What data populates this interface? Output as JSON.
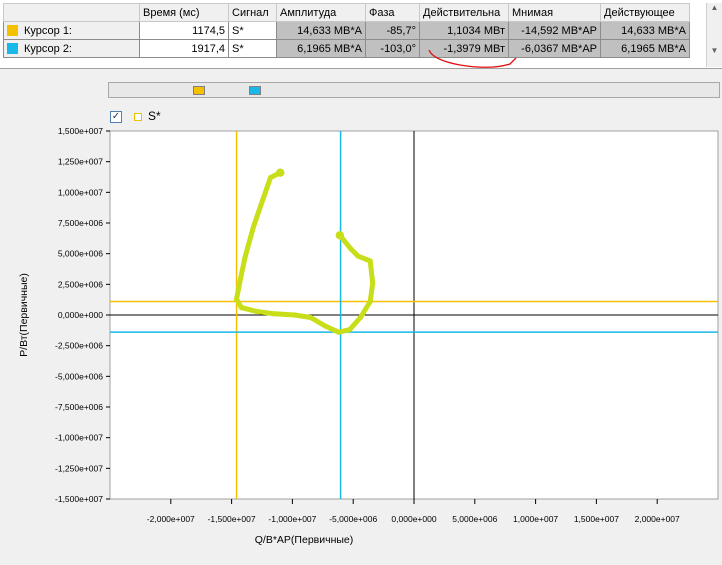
{
  "table": {
    "headers": [
      "",
      "Время (мс)",
      "Сигнал",
      "Амплитуда",
      "Фаза",
      "Действительна",
      "Мнимая",
      "Действующее"
    ],
    "rows": [
      {
        "label": "Курсор 1:",
        "color": "#f5c000",
        "time": "1174,5",
        "signal": "S*",
        "amplitude": "14,633 МВ*А",
        "phase": "-85,7°",
        "real": "1,1034 МВт",
        "imag": "-14,592 МВ*АР",
        "rms": "14,633 МВ*А"
      },
      {
        "label": "Курсор 2:",
        "color": "#18b8e8",
        "time": "1917,4",
        "signal": "S*",
        "amplitude": "6,1965 МВ*А",
        "phase": "-103,0°",
        "real": "-1,3979 МВт",
        "imag": "-6,0367 МВ*АР",
        "rms": "6,1965 МВ*А"
      }
    ]
  },
  "scroll": {
    "up": "▲",
    "down": "▼"
  },
  "legend": {
    "checkbox": "✓",
    "series": "S*"
  },
  "colors": {
    "cursor1": "#f5c000",
    "cursor2": "#18b8e8",
    "trace": "#c8de18",
    "annotation": "#e01010",
    "axis": "#000000"
  },
  "chart_data": {
    "type": "scatter",
    "xlabel": "Q/В*АР(Первичные)",
    "ylabel": "P/Вт(Первичные)",
    "xlim": [
      -25000000.0,
      25000000.0
    ],
    "ylim": [
      -15000000.0,
      15000000.0
    ],
    "x_ticks": [
      -20000000.0,
      -15000000.0,
      -10000000.0,
      -5000000.0,
      0,
      5000000.0,
      10000000.0,
      15000000.0,
      20000000.0
    ],
    "x_tick_labels": [
      "-2,000e+007",
      "-1,500e+007",
      "-1,000e+007",
      "-5,000e+006",
      "0,000e+000",
      "5,000e+006",
      "1,000e+007",
      "1,500e+007",
      "2,000e+007"
    ],
    "y_ticks": [
      15000000.0,
      12500000.0,
      10000000.0,
      7500000.0,
      5000000.0,
      2500000.0,
      0,
      -2500000.0,
      -5000000.0,
      -7500000.0,
      -10000000.0,
      -12500000.0,
      -15000000.0
    ],
    "y_tick_labels": [
      "1,500e+007",
      "1,250e+007",
      "1,000e+007",
      "7,500e+006",
      "5,000e+006",
      "2,500e+006",
      "0,000e+000",
      "-2,500e+006",
      "-5,000e+006",
      "-7,500e+006",
      "-1,000e+007",
      "-1,250e+007",
      "-1,500e+007"
    ],
    "cursor1": {
      "q": -14592000.0,
      "p": 1103400.0
    },
    "cursor2": {
      "q": -6036700.0,
      "p": -1397900.0
    },
    "series": [
      {
        "name": "S*",
        "points": [
          [
            -11000000.0,
            11600000.0
          ],
          [
            -11800000.0,
            11200000.0
          ],
          [
            -12400000.0,
            9500000.0
          ],
          [
            -13200000.0,
            7200000.0
          ],
          [
            -13900000.0,
            4700000.0
          ],
          [
            -14400000.0,
            2300000.0
          ],
          [
            -14600000.0,
            1300000.0
          ],
          [
            -14200000.0,
            600000.0
          ],
          [
            -13000000.0,
            300000.0
          ],
          [
            -11500000.0,
            100000.0
          ],
          [
            -9800000.0,
            0.0
          ],
          [
            -8500000.0,
            -200000.0
          ],
          [
            -7300000.0,
            -900000.0
          ],
          [
            -6200000.0,
            -1400000.0
          ],
          [
            -5300000.0,
            -1200000.0
          ],
          [
            -4400000.0,
            -200000.0
          ],
          [
            -3600000.0,
            1100000.0
          ],
          [
            -3400000.0,
            2600000.0
          ],
          [
            -3600000.0,
            4400000.0
          ],
          [
            -4600000.0,
            4800000.0
          ],
          [
            -5200000.0,
            5400000.0
          ],
          [
            -6100000.0,
            6500000.0
          ]
        ]
      }
    ]
  }
}
